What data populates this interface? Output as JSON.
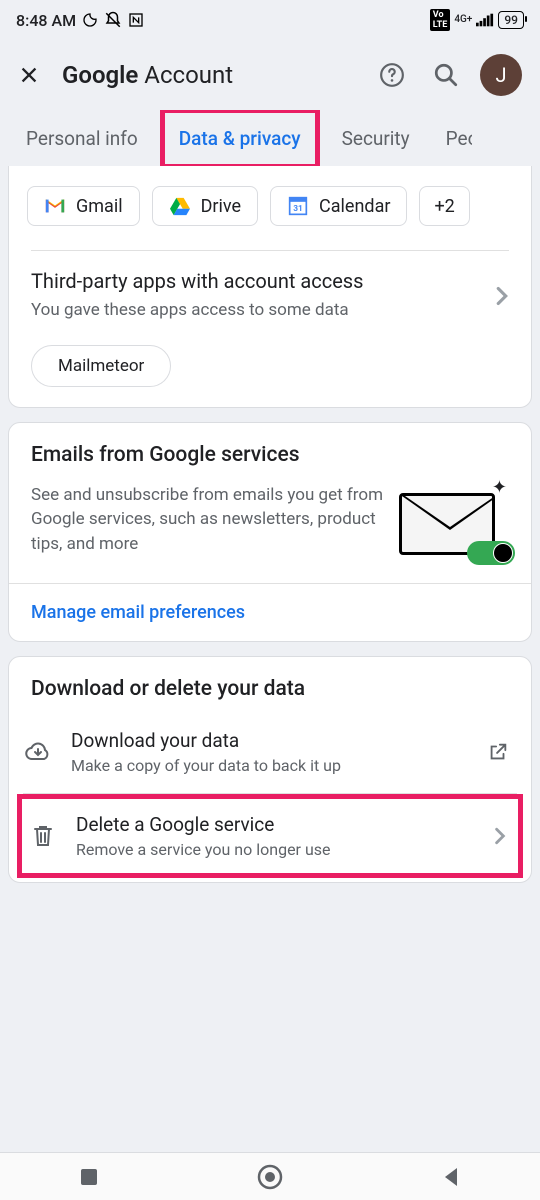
{
  "status": {
    "time": "8:48 AM",
    "network_label": "4G+",
    "battery": "99"
  },
  "header": {
    "brand": "Google",
    "product": "Account",
    "avatar_initial": "J"
  },
  "tabs": {
    "items": [
      "Personal info",
      "Data & privacy",
      "Security",
      "People"
    ],
    "active_index": 1
  },
  "connected_apps": {
    "chips": [
      "Gmail",
      "Drive",
      "Calendar"
    ],
    "overflow": "+2",
    "third_party_title": "Third-party apps with account access",
    "third_party_sub": "You gave these apps access to some data",
    "third_party_app": "Mailmeteor"
  },
  "emails_card": {
    "title": "Emails from Google services",
    "body": "See and unsubscribe from emails you get from Google services, such as newsletters, product tips, and more",
    "link": "Manage email preferences"
  },
  "data_card": {
    "title": "Download or delete your data",
    "download_title": "Download your data",
    "download_sub": "Make a copy of your data to back it up",
    "delete_title": "Delete a Google service",
    "delete_sub": "Remove a service you no longer use"
  }
}
